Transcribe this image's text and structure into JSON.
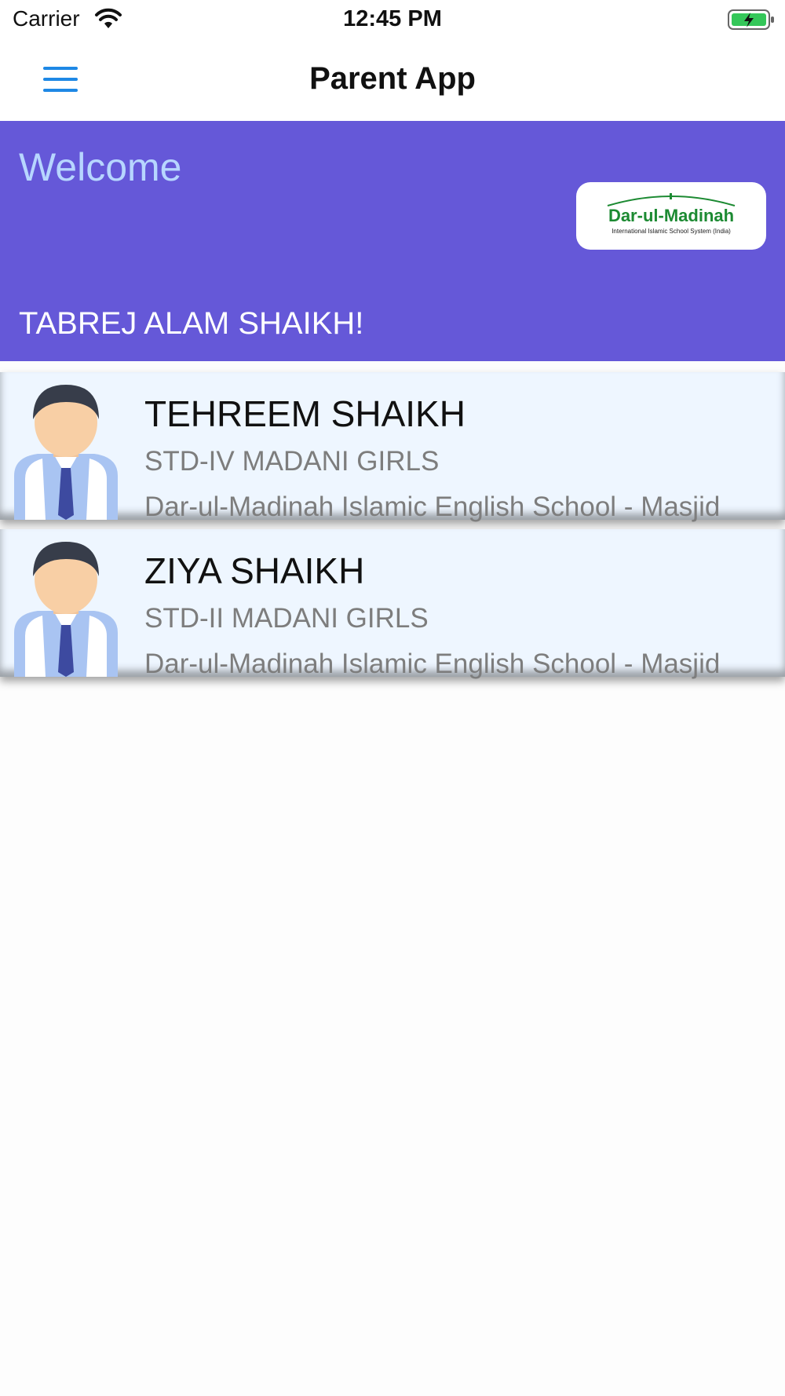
{
  "status_bar": {
    "carrier": "Carrier",
    "time": "12:45 PM",
    "wifi_icon": "wifi-icon",
    "battery_icon": "battery-charging-icon"
  },
  "nav": {
    "title": "Parent App",
    "menu_icon": "hamburger-menu-icon"
  },
  "welcome": {
    "greeting": "Welcome",
    "parent_name": "TABREJ ALAM  SHAIKH!",
    "logo": {
      "name": "Dar-ul-Madinah",
      "tagline": "International Islamic School System (India)"
    }
  },
  "students": [
    {
      "name": "TEHREEM SHAIKH",
      "class": "STD-IV MADANI GIRLS",
      "school": "Dar-ul-Madinah Islamic English School - Masjid"
    },
    {
      "name": "ZIYA SHAIKH",
      "class": "STD-II MADANI GIRLS",
      "school": "Dar-ul-Madinah Islamic English School - Masjid"
    }
  ],
  "colors": {
    "header": "#6558d8",
    "welcome_text": "#b7d6ff",
    "card": "#eef6ff",
    "accent": "#1e88e5",
    "logo_green": "#1c8a32"
  }
}
